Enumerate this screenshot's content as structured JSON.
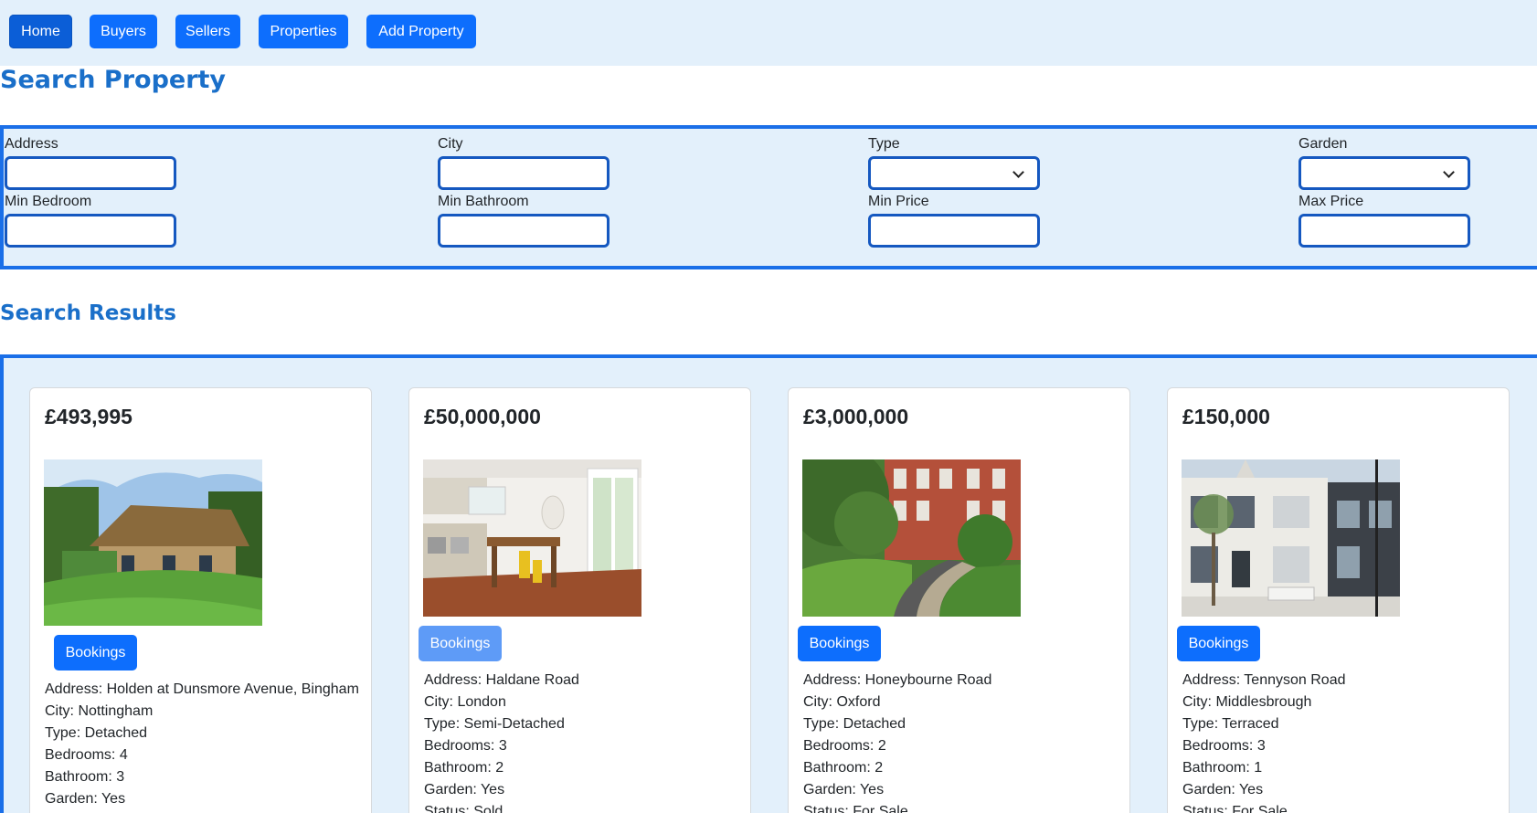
{
  "nav": {
    "items": [
      {
        "label": "Home",
        "active": true
      },
      {
        "label": "Buyers",
        "active": false
      },
      {
        "label": "Sellers",
        "active": false
      },
      {
        "label": "Properties",
        "active": false
      },
      {
        "label": "Add Property",
        "active": false
      }
    ]
  },
  "search": {
    "title": "Search Property",
    "fields": {
      "address": {
        "label": "Address",
        "value": ""
      },
      "city": {
        "label": "City",
        "value": ""
      },
      "type": {
        "label": "Type",
        "value": ""
      },
      "garden": {
        "label": "Garden",
        "value": ""
      },
      "min_bedroom": {
        "label": "Min Bedroom",
        "value": ""
      },
      "min_bathroom": {
        "label": "Min Bathroom",
        "value": ""
      },
      "min_price": {
        "label": "Min Price",
        "value": ""
      },
      "max_price": {
        "label": "Max Price",
        "value": ""
      }
    }
  },
  "results": {
    "title": "Search Results",
    "booking_label": "Bookings",
    "cards": [
      {
        "price": "£493,995",
        "address": "Address: Holden at Dunsmore Avenue, Bingham",
        "city": "City: Nottingham",
        "type": "Type: Detached",
        "bedrooms": "Bedrooms: 4",
        "bathroom": "Bathroom: 3",
        "garden": "Garden: Yes",
        "status": ""
      },
      {
        "price": "£50,000,000",
        "address": "Address: Haldane Road",
        "city": "City: London",
        "type": "Type: Semi-Detached",
        "bedrooms": "Bedrooms: 3",
        "bathroom": "Bathroom: 2",
        "garden": "Garden: Yes",
        "status": "Status: Sold"
      },
      {
        "price": "£3,000,000",
        "address": "Address: Honeybourne Road",
        "city": "City: Oxford",
        "type": "Type: Detached",
        "bedrooms": "Bedrooms: 2",
        "bathroom": "Bathroom: 2",
        "garden": "Garden: Yes",
        "status": "Status: For Sale"
      },
      {
        "price": "£150,000",
        "address": "Address: Tennyson Road",
        "city": "City: Middlesbrough",
        "type": "Type: Terraced",
        "bedrooms": "Bedrooms: 3",
        "bathroom": "Bathroom: 1",
        "garden": "Garden: Yes",
        "status": "Status: For Sale"
      }
    ]
  },
  "colors": {
    "accent": "#0d6efd",
    "heading": "#1a6fc9",
    "panel_bg": "#e3f0fb",
    "panel_border": "#1a6fe8"
  }
}
